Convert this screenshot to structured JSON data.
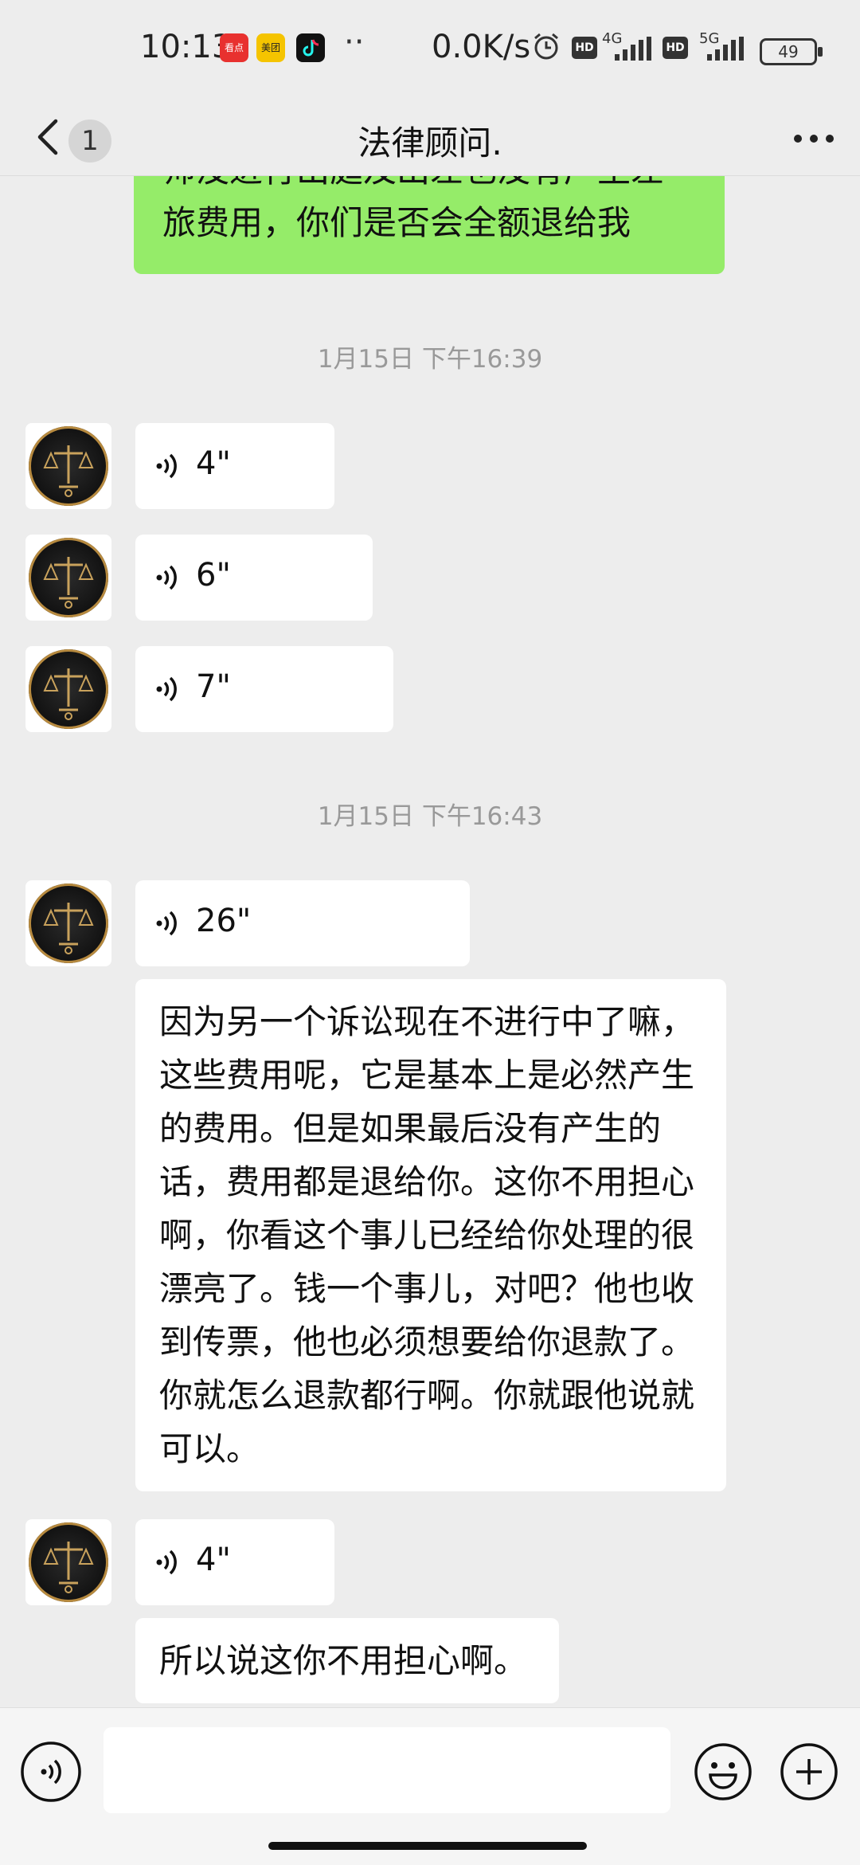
{
  "status_bar": {
    "time": "10:13",
    "apps": [
      "看点",
      "美团",
      "抖音"
    ],
    "more": "··",
    "net_speed": "0.0K/s",
    "hd1": "HD",
    "net1": "4G",
    "hd2": "HD",
    "net2": "5G",
    "battery": "49"
  },
  "header": {
    "unread": "1",
    "title": "法律顾问."
  },
  "messages": {
    "out_1_line1": "师没进行出庭及出差也没有产生差",
    "out_1_line2": "旅费用，你们是否会全额退给我",
    "ts_1": "1月15日 下午16:39",
    "voice_1": "4\"",
    "voice_2": "6\"",
    "voice_3": "7\"",
    "ts_2": "1月15日 下午16:43",
    "voice_4": "26\"",
    "text_1": "因为另一个诉讼现在不进行中了嘛，这些费用呢，它是基本上是必然产生的费用。但是如果最后没有产生的话，费用都是退给你。这你不用担心啊，你看这个事儿已经给你处理的很漂亮了。钱一个事儿，对吧？他也收到传票，他也必须想要给你退款了。你就怎么退款都行啊。你就跟他说就可以。",
    "voice_5": "4\"",
    "text_2": "所以说这你不用担心啊。"
  },
  "icons": {
    "back": "chevron-left-icon",
    "more": "more-dots-icon",
    "voice": "voice-wave-icon",
    "emoji": "emoji-icon",
    "plus": "plus-circle-icon"
  },
  "colors": {
    "background": "#ededed",
    "outgoing_bubble": "#95ec69",
    "incoming_bubble": "#ffffff",
    "timestamp": "#999999"
  }
}
